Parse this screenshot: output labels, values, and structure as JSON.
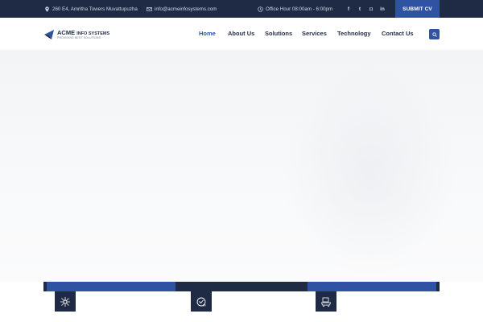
{
  "topbar": {
    "address": "260 E4, Amritha Towers Muvattupuzha",
    "email": "info@acmeinfosystems.com",
    "hours": "Office Hour 08:00am - 6:00pm",
    "social": [
      "facebook-icon",
      "twitter-icon",
      "instagram-icon",
      "linkedin-icon"
    ],
    "social_glyphs": [
      "f",
      "t",
      "◘",
      "in"
    ],
    "submit_cv": "SUBMIT CV"
  },
  "logo": {
    "name_main": "ACME",
    "name_sub": "INFO SYSTEMS",
    "tagline": "PROVIDING BEST SOLUTIONS"
  },
  "nav": {
    "items": [
      "Home",
      "About Us",
      "Solutions",
      "Services",
      "Technology",
      "Contact Us"
    ],
    "active": "Home"
  },
  "features": {
    "icons": [
      "network-icon",
      "support-icon",
      "cart-icon"
    ]
  },
  "colors": {
    "dark": "#1f2a44",
    "accent": "#2f53a2"
  }
}
